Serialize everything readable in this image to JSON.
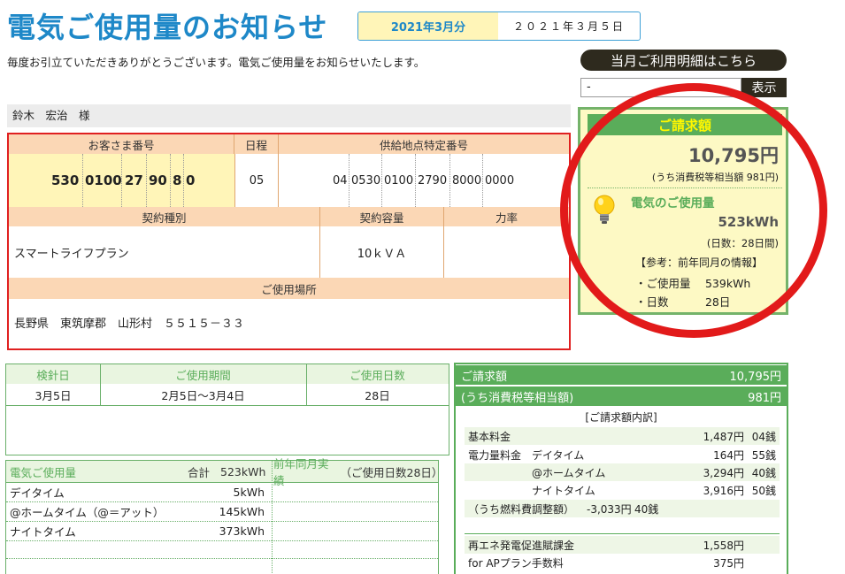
{
  "header": {
    "title": "電気ご使用量のお知らせ",
    "month": "2021年3月分",
    "date": "２０２１年３月５日",
    "greeting": "毎度お引立ていただきありがとうございます。電気ご使用量をお知らせいたします。",
    "detail_button": "当月ご利用明細はこちら",
    "select_value": "-",
    "show_button": "表示"
  },
  "customer": {
    "name": "鈴木　宏治　様",
    "number_label": "お客さま番号",
    "number_parts": [
      "530",
      "0100",
      "27",
      "90",
      "8",
      "0"
    ],
    "schedule_label": "日程",
    "schedule": "05",
    "supply_label": "供給地点特定番号",
    "supply_parts": [
      "04",
      "0530",
      "0100",
      "2790",
      "8000",
      "0000"
    ],
    "contract_type_label": "契約種別",
    "contract_type": "スマートライフプラン",
    "capacity_label": "契約容量",
    "capacity": "10ｋＶＡ",
    "power_factor_label": "力率",
    "power_factor": "",
    "location_label": "ご使用場所",
    "location": "長野県　東筑摩郡　山形村　５５１５－３３"
  },
  "bill_panel": {
    "title": "ご請求額",
    "amount": "10,795円",
    "tax_note": "(うち消費税等相当額 981円)",
    "usage_title": "電気のご使用量",
    "usage": "523kWh",
    "days": "(日数：28日間)",
    "ref_title": "【参考：前年同月の情報】",
    "ref_usage": "・ご使用量　 539kWh",
    "ref_days": "・日数　　　 28日",
    "bulb_icon": "lightbulb-icon"
  },
  "meter": {
    "reading_day_label": "検針日",
    "period_label": "ご使用期間",
    "days_label": "ご使用日数",
    "reading_day": "3月5日",
    "period": "2月5日～3月4日",
    "days": "28日"
  },
  "usage_table": {
    "title": "電気ご使用量",
    "total_label": "合計",
    "total": "523kWh",
    "prev_label": "前年同月実績",
    "prev_days": "（ご使用日数28日）",
    "rows": [
      {
        "label": "デイタイム",
        "value": "5kWh"
      },
      {
        "label": "@ホームタイム（@＝アット）",
        "value": "145kWh"
      },
      {
        "label": "ナイトタイム",
        "value": "373kWh"
      }
    ]
  },
  "charges": {
    "bill_label": "ご請求額",
    "bill": "10,795円",
    "tax_label": "(うち消費税等相当額)",
    "tax": "981円",
    "breakdown_title": "[ご請求額内訳]",
    "base_label": "基本料金",
    "base": "1,487円",
    "base_sen": "04銭",
    "energy_label": "電力量料金",
    "energy_rows": [
      {
        "label": "デイタイム",
        "value": "164円",
        "sen": "55銭"
      },
      {
        "label": "@ホームタイム",
        "value": "3,294円",
        "sen": "40銭"
      },
      {
        "label": "ナイトタイム",
        "value": "3,916円",
        "sen": "50銭"
      }
    ],
    "fuel_label": "（うち燃料費調整額）",
    "fuel": "-3,033円",
    "fuel_sen": "40銭",
    "renewable_label": "再エネ発電促進賦課金",
    "renewable": "1,558円",
    "ap_label": "for APプラン手数料",
    "ap": "375円"
  },
  "colors": {
    "title_blue": "#1e88c8",
    "red_border": "#e02020",
    "green": "#5aad5a",
    "peach": "#fbd7b5",
    "cream": "#fdf9c4"
  }
}
